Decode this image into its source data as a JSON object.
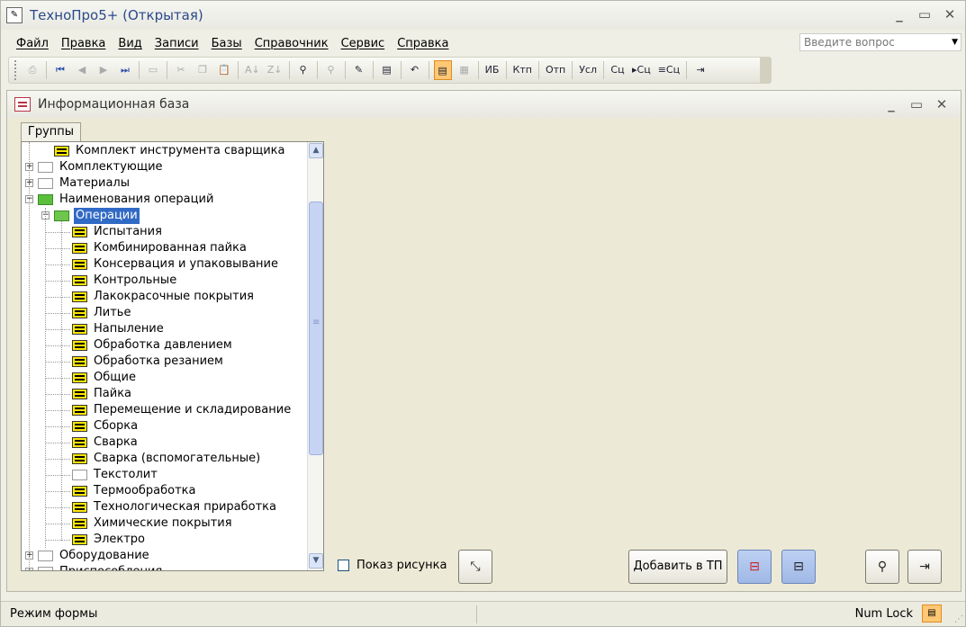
{
  "app": {
    "title": "ТехноПро5+ (Открытая)"
  },
  "menu": {
    "items": [
      "Файл",
      "Правка",
      "Вид",
      "Записи",
      "Базы",
      "Справочник",
      "Сервис",
      "Справка"
    ],
    "help_placeholder": "Введите вопрос"
  },
  "toolbar": {
    "text_buttons": [
      "ИБ",
      "Ктп",
      "Отп",
      "Усл",
      "Сц",
      "▸Сц",
      "≡Сц"
    ]
  },
  "child_window": {
    "title": "Информационная база",
    "tab_label": "Группы"
  },
  "tree": {
    "items": [
      {
        "label": "Комплект инструмента сварщика",
        "level": 1,
        "icon": "list",
        "expander": ""
      },
      {
        "label": "Комплектующие",
        "level": 0,
        "icon": "empty",
        "expander": "+"
      },
      {
        "label": "Материалы",
        "level": 0,
        "icon": "empty",
        "expander": "+"
      },
      {
        "label": "Наименования операций",
        "level": 0,
        "icon": "green",
        "expander": "−"
      },
      {
        "label": "Операции",
        "level": 1,
        "icon": "greenfolder",
        "expander": "−",
        "selected": true
      },
      {
        "label": "Испытания",
        "level": 2,
        "icon": "list"
      },
      {
        "label": "Комбинированная пайка",
        "level": 2,
        "icon": "list"
      },
      {
        "label": "Консервация и упаковывание",
        "level": 2,
        "icon": "list"
      },
      {
        "label": "Контрольные",
        "level": 2,
        "icon": "list"
      },
      {
        "label": "Лакокрасочные покрытия",
        "level": 2,
        "icon": "list"
      },
      {
        "label": "Литье",
        "level": 2,
        "icon": "list"
      },
      {
        "label": "Напыление",
        "level": 2,
        "icon": "list"
      },
      {
        "label": "Обработка давлением",
        "level": 2,
        "icon": "list"
      },
      {
        "label": "Обработка резанием",
        "level": 2,
        "icon": "list"
      },
      {
        "label": "Общие",
        "level": 2,
        "icon": "list"
      },
      {
        "label": "Пайка",
        "level": 2,
        "icon": "list"
      },
      {
        "label": "Перемещение и складирование",
        "level": 2,
        "icon": "list"
      },
      {
        "label": "Сборка",
        "level": 2,
        "icon": "list"
      },
      {
        "label": "Сварка",
        "level": 2,
        "icon": "list"
      },
      {
        "label": "Сварка (вспомогательные)",
        "level": 2,
        "icon": "list"
      },
      {
        "label": "Текстолит",
        "level": 2,
        "icon": "empty"
      },
      {
        "label": "Термообработка",
        "level": 2,
        "icon": "list"
      },
      {
        "label": "Технологическая приработка",
        "level": 2,
        "icon": "list"
      },
      {
        "label": "Химические покрытия",
        "level": 2,
        "icon": "list"
      },
      {
        "label": "Электро",
        "level": 2,
        "icon": "list"
      },
      {
        "label": "Оборудование",
        "level": 0,
        "icon": "empty",
        "expander": "+"
      },
      {
        "label": "Приспособления",
        "level": 0,
        "icon": "empty",
        "expander": "+"
      }
    ]
  },
  "controls": {
    "show_picture_label": "Показ рисунка",
    "show_picture_checked": false,
    "add_to_tp_label": "Добавить в ТП"
  },
  "status": {
    "mode": "Режим формы",
    "numlock": "Num Lock"
  }
}
